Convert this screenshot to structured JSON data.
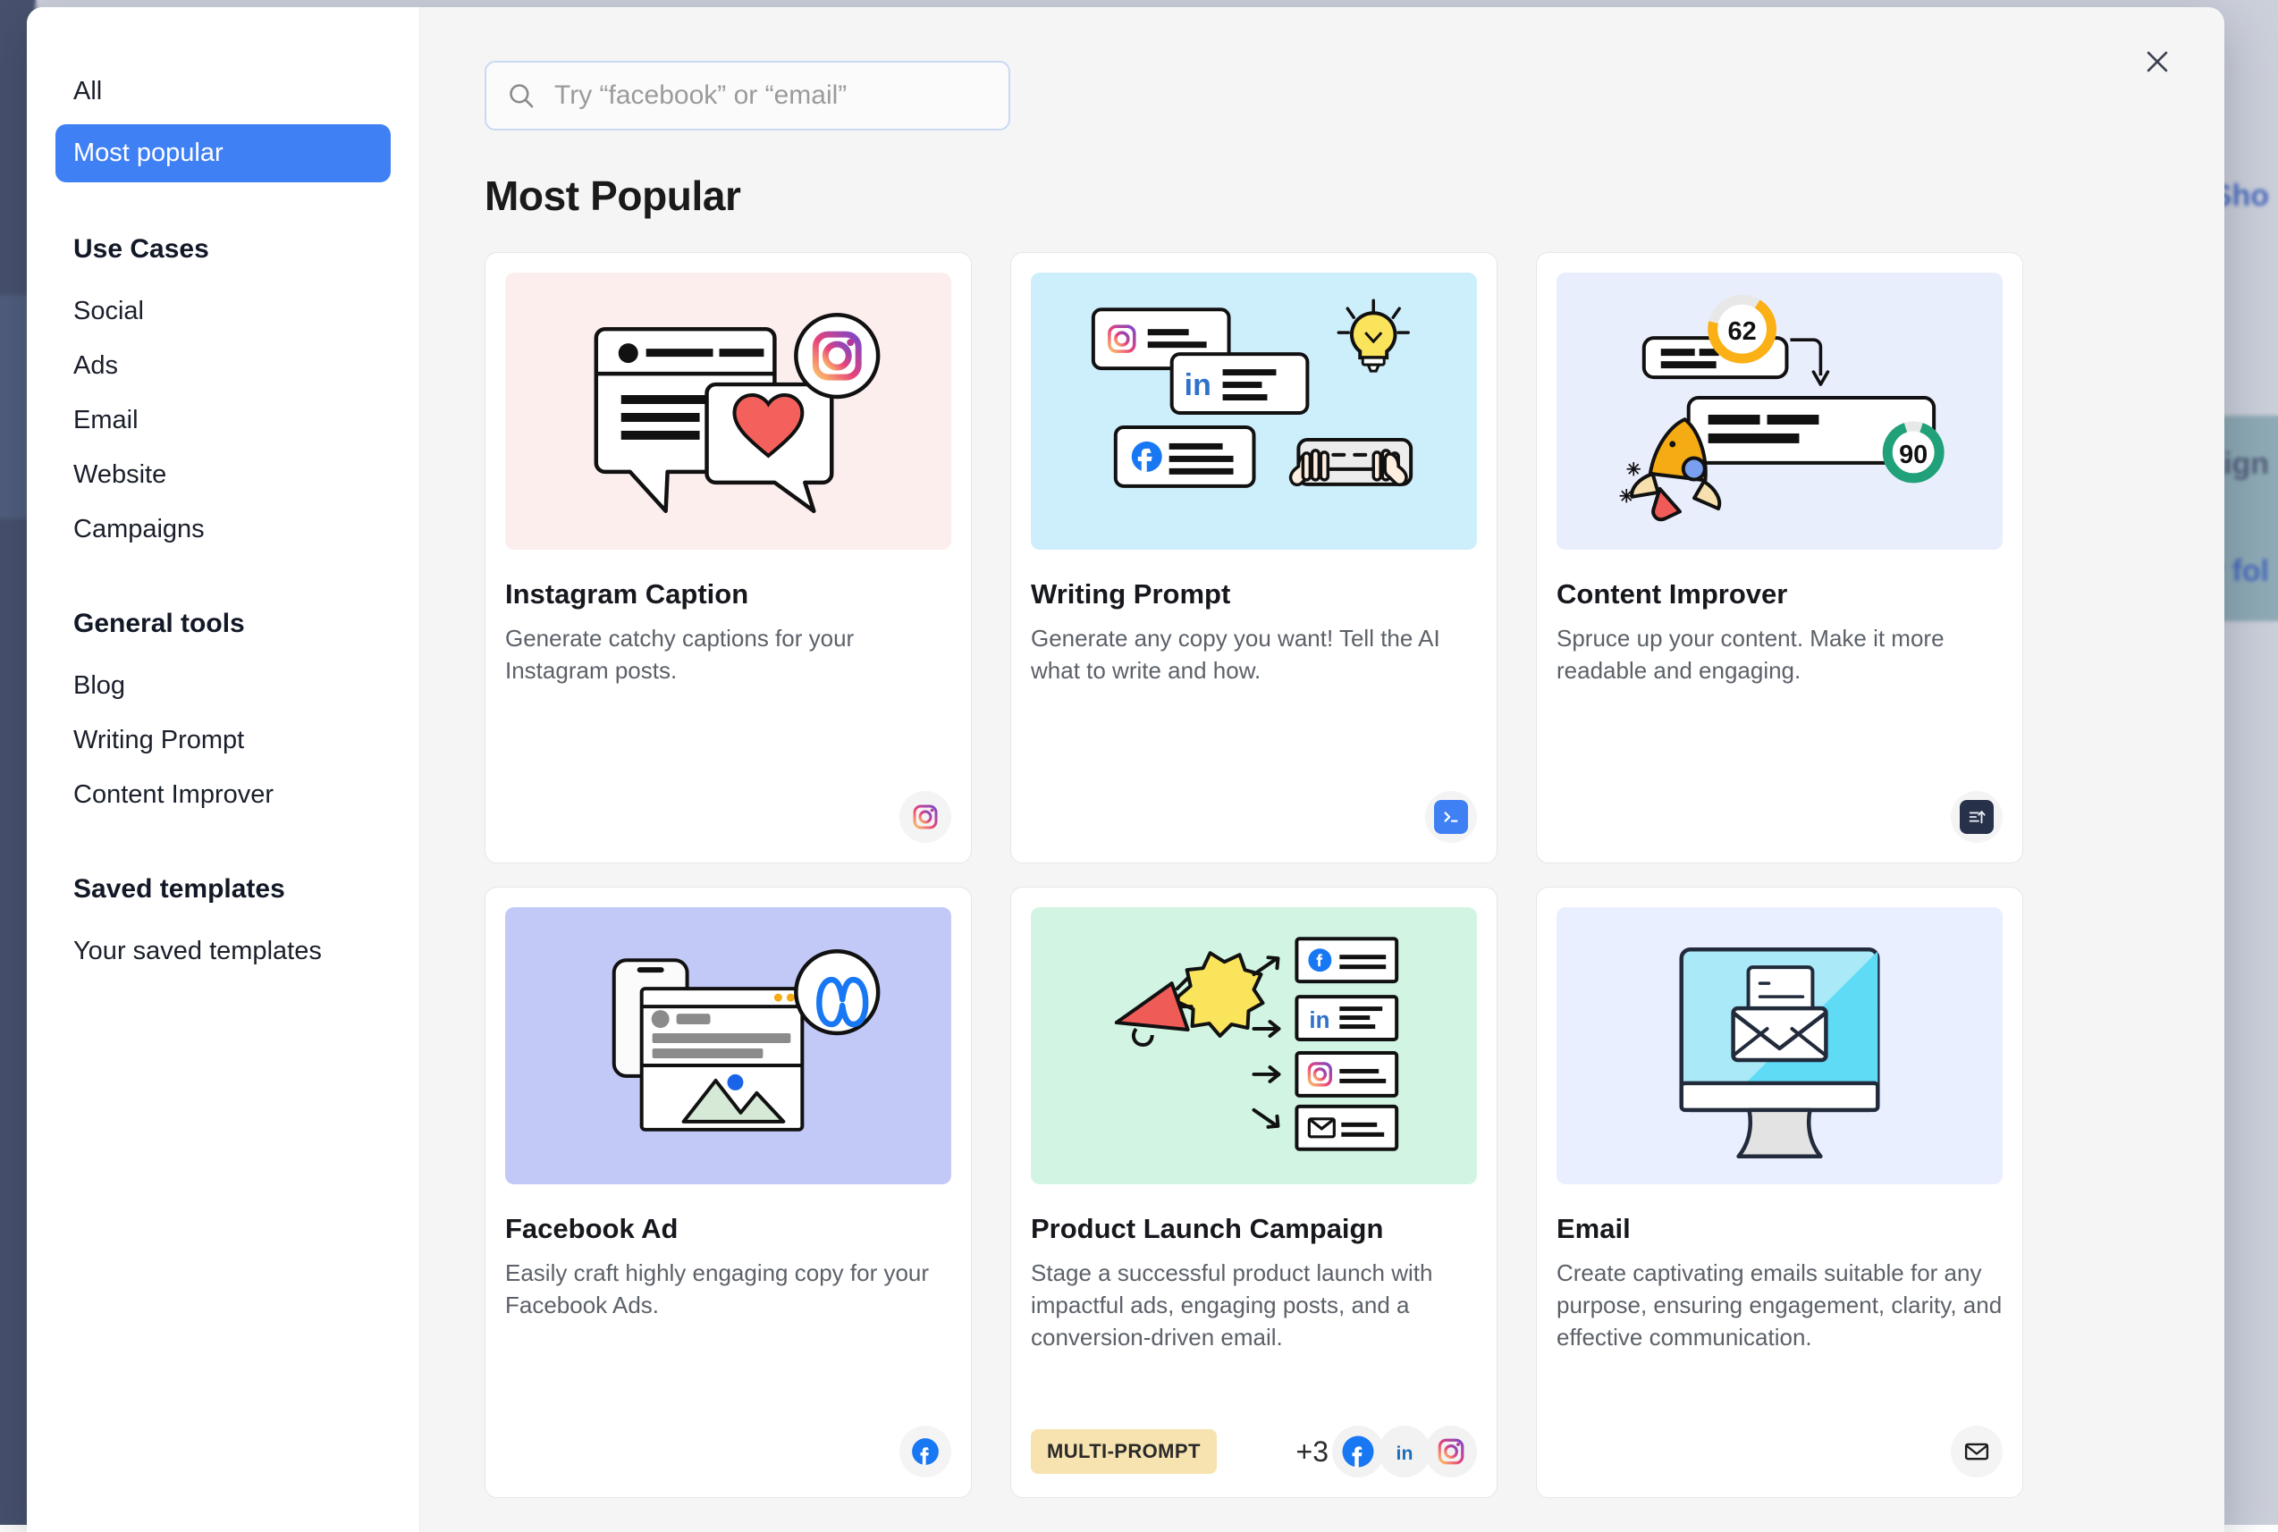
{
  "colors": {
    "accent_blue": "#4080f5",
    "badge_bg": "#f7e3b0",
    "sidebar_bg": "#ffffff",
    "modal_bg": "#f5f5f5"
  },
  "background_app": {
    "visible_texts": [
      "Sho",
      "paign",
      "w fol"
    ]
  },
  "modal": {
    "close_icon": "close-icon"
  },
  "sidebar": {
    "top_items": [
      {
        "label": "All",
        "active": false
      },
      {
        "label": "Most popular",
        "active": true
      }
    ],
    "groups": [
      {
        "heading": "Use Cases",
        "items": [
          "Social",
          "Ads",
          "Email",
          "Website",
          "Campaigns"
        ]
      },
      {
        "heading": "General tools",
        "items": [
          "Blog",
          "Writing Prompt",
          "Content Improver"
        ]
      },
      {
        "heading": "Saved templates",
        "items": [
          "Your saved templates"
        ]
      }
    ]
  },
  "search": {
    "icon": "search-icon",
    "placeholder": "Try “facebook” or “email”",
    "value": ""
  },
  "main": {
    "section_title": "Most Popular"
  },
  "cards": [
    {
      "title": "Instagram Caption",
      "description": "Generate catchy captions for your Instagram posts.",
      "art": "instagram-caption-art",
      "art_bg": "#fdeeee",
      "badge": null,
      "plus_count": null,
      "icons": [
        "instagram-icon"
      ]
    },
    {
      "title": "Writing Prompt",
      "description": "Generate any copy you want! Tell the AI what to write and how.",
      "art": "writing-prompt-art",
      "art_bg": "#cdeefb",
      "badge": null,
      "plus_count": null,
      "icons": [
        "terminal-icon"
      ]
    },
    {
      "title": "Content Improver",
      "description": "Spruce up your content. Make it more readable and engaging.",
      "art": "content-improver-art",
      "art_bg": "#e9eefd",
      "badge": null,
      "plus_count": null,
      "icons": [
        "content-improver-icon"
      ],
      "scores": [
        62,
        90
      ]
    },
    {
      "title": "Facebook Ad",
      "description": "Easily craft highly engaging copy for your Facebook Ads.",
      "art": "facebook-ad-art",
      "art_bg": "#c2c9f7",
      "badge": null,
      "plus_count": null,
      "icons": [
        "facebook-icon"
      ]
    },
    {
      "title": "Product Launch Campaign",
      "description": "Stage a successful product launch with impactful ads, engaging posts, and a conversion-driven email.",
      "art": "product-launch-art",
      "art_bg": "#d2f5e3",
      "badge": "MULTI-PROMPT",
      "plus_count": "+3",
      "icons": [
        "facebook-icon",
        "linkedin-icon",
        "instagram-icon"
      ]
    },
    {
      "title": "Email",
      "description": "Create captivating emails suitable for any purpose, ensuring engagement, clarity, and effective communication.",
      "art": "email-art",
      "art_bg": "#e9efff",
      "badge": null,
      "plus_count": null,
      "icons": [
        "envelope-icon"
      ]
    }
  ]
}
